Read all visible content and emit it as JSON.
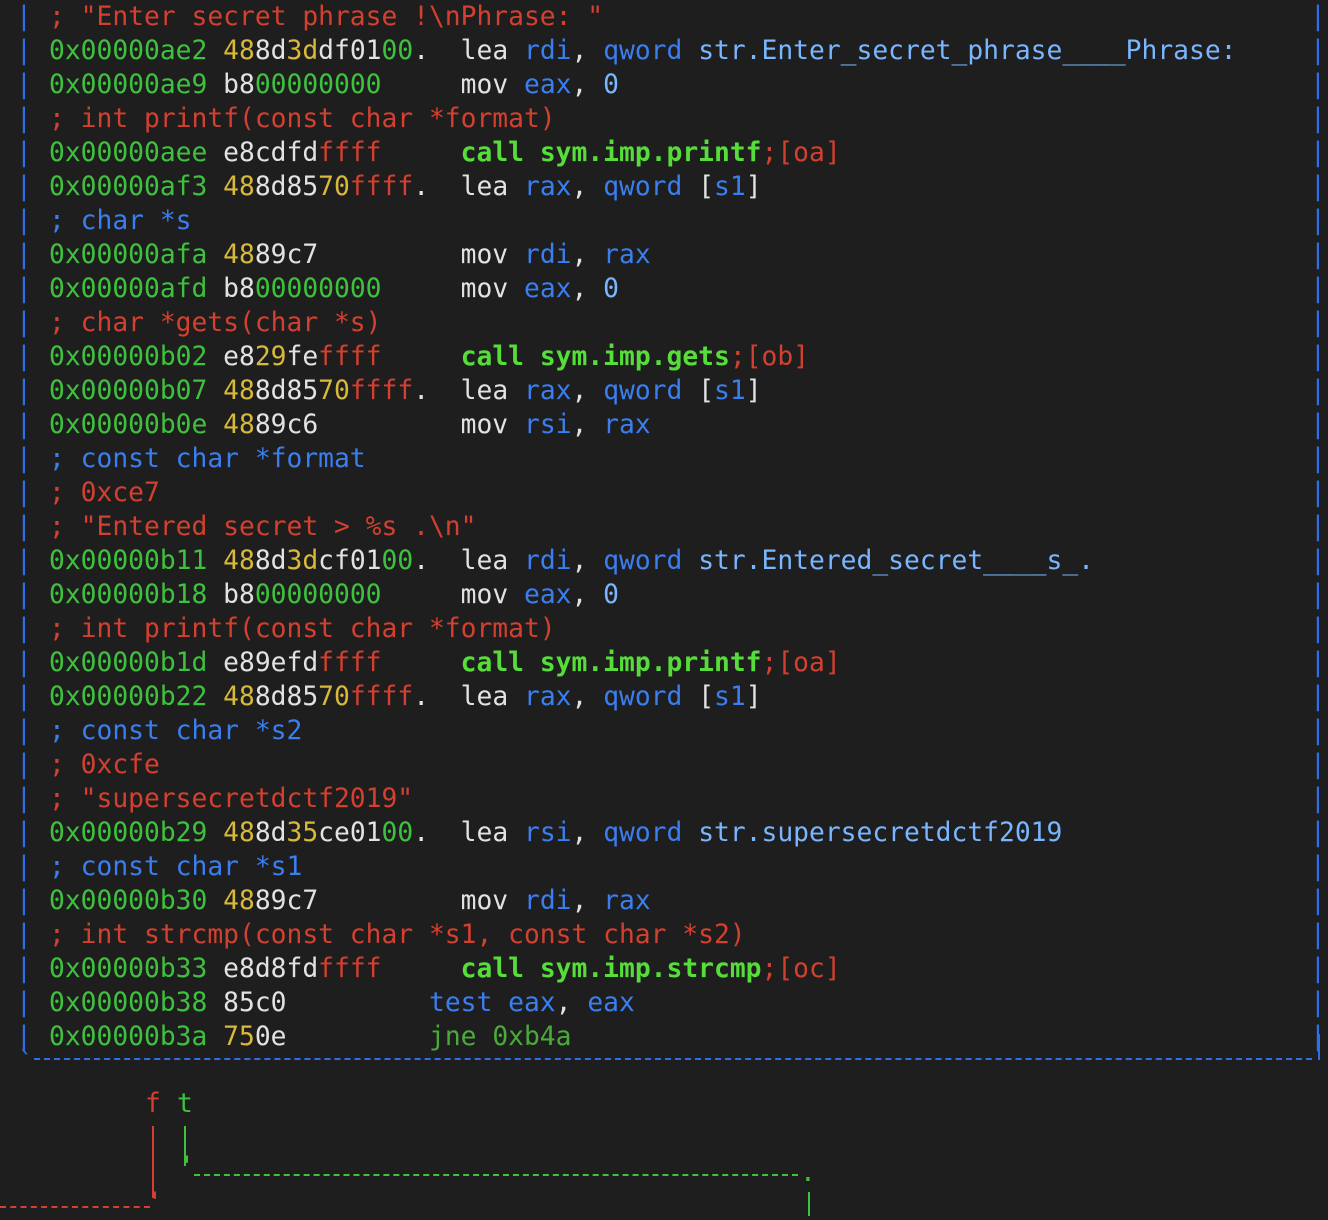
{
  "colors": {
    "background": "#1e1e1e",
    "comment": "#d4402f",
    "address": "#3ec23e",
    "bytes_hi": "#d8b93a",
    "text": "#e2e2e2",
    "register": "#3a7ef0",
    "string_ref": "#7ab6ff",
    "call": "#56dd3a",
    "box_border": "#2f6ee6"
  },
  "lines": [
    {
      "t": "c",
      "tokens": [
        {
          "c": "c-red",
          "s": "; \"Enter secret phrase !\\nPhrase: \""
        }
      ]
    },
    {
      "t": "i",
      "tokens": [
        {
          "c": "c-green",
          "s": "0x00000ae2 "
        },
        {
          "c": "c-yellow",
          "s": "48"
        },
        {
          "c": "c-white",
          "s": "8d"
        },
        {
          "c": "c-yellow",
          "s": "3d"
        },
        {
          "c": "c-white",
          "s": "df01"
        },
        {
          "c": "c-green",
          "s": "00"
        },
        {
          "c": "c-white",
          "s": ".  lea "
        },
        {
          "c": "c-blue",
          "s": "rdi"
        },
        {
          "c": "c-white",
          "s": ", "
        },
        {
          "c": "c-blue",
          "s": "qword "
        },
        {
          "c": "c-cyan",
          "s": "str.Enter_secret_phrase____Phrase:"
        }
      ]
    },
    {
      "t": "i",
      "tokens": [
        {
          "c": "c-green",
          "s": "0x00000ae9 "
        },
        {
          "c": "c-white",
          "s": "b8"
        },
        {
          "c": "c-green",
          "s": "00000000"
        },
        {
          "c": "c-white",
          "s": "     mov "
        },
        {
          "c": "c-blue",
          "s": "eax"
        },
        {
          "c": "c-white",
          "s": ", "
        },
        {
          "c": "c-cyan",
          "s": "0"
        }
      ]
    },
    {
      "t": "c",
      "tokens": [
        {
          "c": "c-red",
          "s": "; int printf(const char *format)"
        }
      ]
    },
    {
      "t": "i",
      "tokens": [
        {
          "c": "c-green",
          "s": "0x00000aee "
        },
        {
          "c": "c-white",
          "s": "e8cdfd"
        },
        {
          "c": "c-red",
          "s": "ffff"
        },
        {
          "c": "c-white",
          "s": "     "
        },
        {
          "c": "c-bgreen",
          "s": "call sym.imp.printf"
        },
        {
          "c": "c-red",
          "s": ";[oa]"
        }
      ]
    },
    {
      "t": "i",
      "tokens": [
        {
          "c": "c-green",
          "s": "0x00000af3 "
        },
        {
          "c": "c-yellow",
          "s": "48"
        },
        {
          "c": "c-white",
          "s": "8d85"
        },
        {
          "c": "c-yellow",
          "s": "70"
        },
        {
          "c": "c-red",
          "s": "ffff"
        },
        {
          "c": "c-white",
          "s": ".  lea "
        },
        {
          "c": "c-blue",
          "s": "rax"
        },
        {
          "c": "c-white",
          "s": ", "
        },
        {
          "c": "c-blue",
          "s": "qword "
        },
        {
          "c": "c-white",
          "s": "["
        },
        {
          "c": "c-blue",
          "s": "s1"
        },
        {
          "c": "c-white",
          "s": "]"
        }
      ]
    },
    {
      "t": "c",
      "tokens": [
        {
          "c": "c-blue",
          "s": "; char *s"
        }
      ]
    },
    {
      "t": "i",
      "tokens": [
        {
          "c": "c-green",
          "s": "0x00000afa "
        },
        {
          "c": "c-yellow",
          "s": "48"
        },
        {
          "c": "c-white",
          "s": "89c7         mov "
        },
        {
          "c": "c-blue",
          "s": "rdi"
        },
        {
          "c": "c-white",
          "s": ", "
        },
        {
          "c": "c-blue",
          "s": "rax"
        }
      ]
    },
    {
      "t": "i",
      "tokens": [
        {
          "c": "c-green",
          "s": "0x00000afd "
        },
        {
          "c": "c-white",
          "s": "b8"
        },
        {
          "c": "c-green",
          "s": "00000000"
        },
        {
          "c": "c-white",
          "s": "     mov "
        },
        {
          "c": "c-blue",
          "s": "eax"
        },
        {
          "c": "c-white",
          "s": ", "
        },
        {
          "c": "c-cyan",
          "s": "0"
        }
      ]
    },
    {
      "t": "c",
      "tokens": [
        {
          "c": "c-red",
          "s": "; char *gets(char *s)"
        }
      ]
    },
    {
      "t": "i",
      "tokens": [
        {
          "c": "c-green",
          "s": "0x00000b02 "
        },
        {
          "c": "c-white",
          "s": "e8"
        },
        {
          "c": "c-yellow",
          "s": "29"
        },
        {
          "c": "c-white",
          "s": "fe"
        },
        {
          "c": "c-red",
          "s": "ffff"
        },
        {
          "c": "c-white",
          "s": "     "
        },
        {
          "c": "c-bgreen",
          "s": "call sym.imp.gets"
        },
        {
          "c": "c-red",
          "s": ";[ob]"
        }
      ]
    },
    {
      "t": "i",
      "tokens": [
        {
          "c": "c-green",
          "s": "0x00000b07 "
        },
        {
          "c": "c-yellow",
          "s": "48"
        },
        {
          "c": "c-white",
          "s": "8d85"
        },
        {
          "c": "c-yellow",
          "s": "70"
        },
        {
          "c": "c-red",
          "s": "ffff"
        },
        {
          "c": "c-white",
          "s": ".  lea "
        },
        {
          "c": "c-blue",
          "s": "rax"
        },
        {
          "c": "c-white",
          "s": ", "
        },
        {
          "c": "c-blue",
          "s": "qword "
        },
        {
          "c": "c-white",
          "s": "["
        },
        {
          "c": "c-blue",
          "s": "s1"
        },
        {
          "c": "c-white",
          "s": "]"
        }
      ]
    },
    {
      "t": "i",
      "tokens": [
        {
          "c": "c-green",
          "s": "0x00000b0e "
        },
        {
          "c": "c-yellow",
          "s": "48"
        },
        {
          "c": "c-white",
          "s": "89c6         mov "
        },
        {
          "c": "c-blue",
          "s": "rsi"
        },
        {
          "c": "c-white",
          "s": ", "
        },
        {
          "c": "c-blue",
          "s": "rax"
        }
      ]
    },
    {
      "t": "c",
      "tokens": [
        {
          "c": "c-blue",
          "s": "; const char *format"
        }
      ]
    },
    {
      "t": "c",
      "tokens": [
        {
          "c": "c-red",
          "s": "; 0xce7"
        }
      ]
    },
    {
      "t": "c",
      "tokens": [
        {
          "c": "c-red",
          "s": "; \"Entered secret > %s .\\n\""
        }
      ]
    },
    {
      "t": "i",
      "tokens": [
        {
          "c": "c-green",
          "s": "0x00000b11 "
        },
        {
          "c": "c-yellow",
          "s": "48"
        },
        {
          "c": "c-white",
          "s": "8d"
        },
        {
          "c": "c-yellow",
          "s": "3d"
        },
        {
          "c": "c-white",
          "s": "cf01"
        },
        {
          "c": "c-green",
          "s": "00"
        },
        {
          "c": "c-white",
          "s": ".  lea "
        },
        {
          "c": "c-blue",
          "s": "rdi"
        },
        {
          "c": "c-white",
          "s": ", "
        },
        {
          "c": "c-blue",
          "s": "qword "
        },
        {
          "c": "c-cyan",
          "s": "str.Entered_secret____s_."
        }
      ]
    },
    {
      "t": "i",
      "tokens": [
        {
          "c": "c-green",
          "s": "0x00000b18 "
        },
        {
          "c": "c-white",
          "s": "b8"
        },
        {
          "c": "c-green",
          "s": "00000000"
        },
        {
          "c": "c-white",
          "s": "     mov "
        },
        {
          "c": "c-blue",
          "s": "eax"
        },
        {
          "c": "c-white",
          "s": ", "
        },
        {
          "c": "c-cyan",
          "s": "0"
        }
      ]
    },
    {
      "t": "c",
      "tokens": [
        {
          "c": "c-red",
          "s": "; int printf(const char *format)"
        }
      ]
    },
    {
      "t": "i",
      "tokens": [
        {
          "c": "c-green",
          "s": "0x00000b1d "
        },
        {
          "c": "c-white",
          "s": "e89efd"
        },
        {
          "c": "c-red",
          "s": "ffff"
        },
        {
          "c": "c-white",
          "s": "     "
        },
        {
          "c": "c-bgreen",
          "s": "call sym.imp.printf"
        },
        {
          "c": "c-red",
          "s": ";[oa]"
        }
      ]
    },
    {
      "t": "i",
      "tokens": [
        {
          "c": "c-green",
          "s": "0x00000b22 "
        },
        {
          "c": "c-yellow",
          "s": "48"
        },
        {
          "c": "c-white",
          "s": "8d85"
        },
        {
          "c": "c-yellow",
          "s": "70"
        },
        {
          "c": "c-red",
          "s": "ffff"
        },
        {
          "c": "c-white",
          "s": ".  lea "
        },
        {
          "c": "c-blue",
          "s": "rax"
        },
        {
          "c": "c-white",
          "s": ", "
        },
        {
          "c": "c-blue",
          "s": "qword "
        },
        {
          "c": "c-white",
          "s": "["
        },
        {
          "c": "c-blue",
          "s": "s1"
        },
        {
          "c": "c-white",
          "s": "]"
        }
      ]
    },
    {
      "t": "c",
      "tokens": [
        {
          "c": "c-blue",
          "s": "; const char *s2"
        }
      ]
    },
    {
      "t": "c",
      "tokens": [
        {
          "c": "c-red",
          "s": "; 0xcfe"
        }
      ]
    },
    {
      "t": "c",
      "tokens": [
        {
          "c": "c-red",
          "s": "; \"supersecretdctf2019\""
        }
      ]
    },
    {
      "t": "i",
      "tokens": [
        {
          "c": "c-green",
          "s": "0x00000b29 "
        },
        {
          "c": "c-yellow",
          "s": "48"
        },
        {
          "c": "c-white",
          "s": "8d"
        },
        {
          "c": "c-yellow",
          "s": "35"
        },
        {
          "c": "c-white",
          "s": "ce01"
        },
        {
          "c": "c-green",
          "s": "00"
        },
        {
          "c": "c-white",
          "s": ".  lea "
        },
        {
          "c": "c-blue",
          "s": "rsi"
        },
        {
          "c": "c-white",
          "s": ", "
        },
        {
          "c": "c-blue",
          "s": "qword "
        },
        {
          "c": "c-cyan",
          "s": "str.supersecretdctf2019"
        }
      ]
    },
    {
      "t": "c",
      "tokens": [
        {
          "c": "c-blue",
          "s": "; const char *s1"
        }
      ]
    },
    {
      "t": "i",
      "tokens": [
        {
          "c": "c-green",
          "s": "0x00000b30 "
        },
        {
          "c": "c-yellow",
          "s": "48"
        },
        {
          "c": "c-white",
          "s": "89c7         mov "
        },
        {
          "c": "c-blue",
          "s": "rdi"
        },
        {
          "c": "c-white",
          "s": ", "
        },
        {
          "c": "c-blue",
          "s": "rax"
        }
      ]
    },
    {
      "t": "c",
      "tokens": [
        {
          "c": "c-red",
          "s": "; int strcmp(const char *s1, const char *s2)"
        }
      ]
    },
    {
      "t": "i",
      "tokens": [
        {
          "c": "c-green",
          "s": "0x00000b33 "
        },
        {
          "c": "c-white",
          "s": "e8d8fd"
        },
        {
          "c": "c-red",
          "s": "ffff"
        },
        {
          "c": "c-white",
          "s": "     "
        },
        {
          "c": "c-bgreen",
          "s": "call sym.imp.strcmp"
        },
        {
          "c": "c-red",
          "s": ";[oc]"
        }
      ]
    },
    {
      "t": "i",
      "tokens": [
        {
          "c": "c-green",
          "s": "0x00000b38 "
        },
        {
          "c": "c-white",
          "s": "85c0         "
        },
        {
          "c": "c-blue",
          "s": "test eax"
        },
        {
          "c": "c-white",
          "s": ", "
        },
        {
          "c": "c-blue",
          "s": "eax"
        }
      ]
    },
    {
      "t": "i",
      "tokens": [
        {
          "c": "c-green",
          "s": "0x00000b3a "
        },
        {
          "c": "c-yellow",
          "s": "75"
        },
        {
          "c": "c-white",
          "s": "0e         "
        },
        {
          "c": "c-dgreen",
          "s": "jne 0xb4a"
        }
      ]
    }
  ],
  "branch": {
    "false_label": "f",
    "true_label": "t",
    "pipe": "|",
    "corner_a": "'",
    "corner_b": ".",
    "box_corner": "`",
    "box_bottom_fill": "-"
  }
}
